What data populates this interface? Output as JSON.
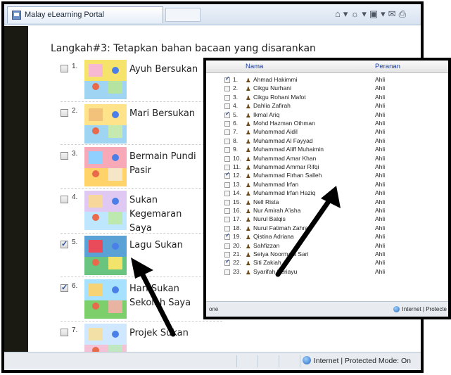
{
  "window": {
    "tab_title": "Malay eLearning Portal",
    "status": "Internet | Protected Mode: On"
  },
  "page": {
    "heading": "Langkah#3: Tetapkan bahan bacaan yang disarankan"
  },
  "items": [
    {
      "num": "1.",
      "title": "Ayuh Bersukan",
      "checked": false
    },
    {
      "num": "2.",
      "title": "Mari Bersukan",
      "checked": false
    },
    {
      "num": "3.",
      "title": "Bermain Pundi Pasir",
      "checked": false
    },
    {
      "num": "4.",
      "title": "Sukan Kegemaran Saya",
      "checked": false
    },
    {
      "num": "5.",
      "title": "Lagu Sukan",
      "checked": true
    },
    {
      "num": "6.",
      "title": "Hari Sukan Sekolah Saya",
      "checked": true
    },
    {
      "num": "7.",
      "title": "Projek Sukan",
      "checked": false
    }
  ],
  "popup": {
    "col_name": "Nama",
    "col_role": "Peranan",
    "status_left": "one",
    "status_right": "Internet | Protecte",
    "rows": [
      {
        "num": "1.",
        "name": "Ahmad Hakimmi",
        "role": "Ahli",
        "checked": true
      },
      {
        "num": "2.",
        "name": "Cikgu Nurhani",
        "role": "Ahli",
        "checked": false
      },
      {
        "num": "3.",
        "name": "Cikgu Rohani Mafot",
        "role": "Ahli",
        "checked": false
      },
      {
        "num": "4.",
        "name": "Dahlia Zafirah",
        "role": "Ahli",
        "checked": false
      },
      {
        "num": "5.",
        "name": "Ikmal Ariq",
        "role": "Ahli",
        "checked": true
      },
      {
        "num": "6.",
        "name": "Mohd Hazman Othman",
        "role": "Ahli",
        "checked": false
      },
      {
        "num": "7.",
        "name": "Muhammad Aidil",
        "role": "Ahli",
        "checked": false
      },
      {
        "num": "8.",
        "name": "Muhammad Al Fayyad",
        "role": "Ahli",
        "checked": false
      },
      {
        "num": "9.",
        "name": "Muhammad Aliff Muhaimin",
        "role": "Ahli",
        "checked": false
      },
      {
        "num": "10.",
        "name": "Muhammad Amar Khan",
        "role": "Ahli",
        "checked": false
      },
      {
        "num": "11.",
        "name": "Muhammad Ammar Rifqi",
        "role": "Ahli",
        "checked": false
      },
      {
        "num": "12.",
        "name": "Muhammad Firhan Salleh",
        "role": "Ahli",
        "checked": true
      },
      {
        "num": "13.",
        "name": "Muhammad Irfan",
        "role": "Ahli",
        "checked": false
      },
      {
        "num": "14.",
        "name": "Muhammad Irfan Haziq",
        "role": "Ahli",
        "checked": false
      },
      {
        "num": "15.",
        "name": "Nell Rista",
        "role": "Ahli",
        "checked": false
      },
      {
        "num": "16.",
        "name": "Nur Amirah A'isha",
        "role": "Ahli",
        "checked": false
      },
      {
        "num": "17.",
        "name": "Nurul Balqis",
        "role": "Ahli",
        "checked": false
      },
      {
        "num": "18.",
        "name": "Nurul Fatimah Zahra",
        "role": "Ahli",
        "checked": false
      },
      {
        "num": "19.",
        "name": "Qistina Adriana",
        "role": "Ahli",
        "checked": true
      },
      {
        "num": "20.",
        "name": "Sahfizzan",
        "role": "Ahli",
        "checked": false
      },
      {
        "num": "21.",
        "name": "Setya Noormala Sari",
        "role": "Ahli",
        "checked": false
      },
      {
        "num": "22.",
        "name": "Siti Zakiah",
        "role": "Ahli",
        "checked": true
      },
      {
        "num": "23.",
        "name": "Syarifah Seriayu",
        "role": "Ahli",
        "checked": false
      }
    ]
  }
}
